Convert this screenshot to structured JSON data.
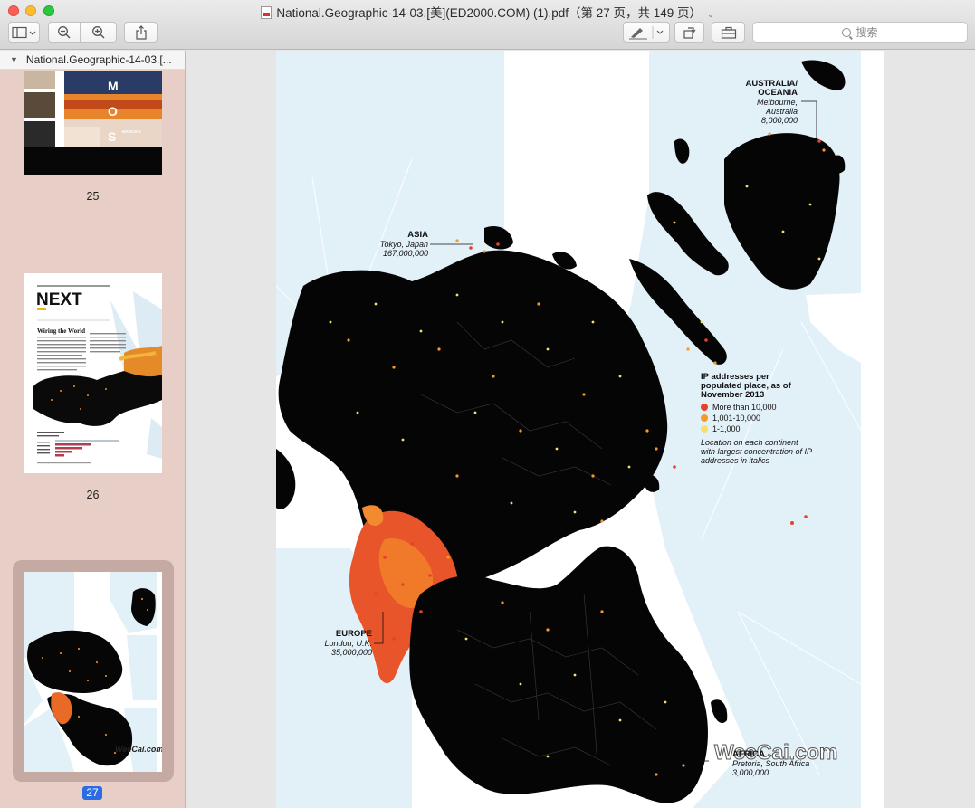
{
  "window": {
    "title": "National.Geographic-14-03.[美](ED2000.COM) (1).pdf（第 27 页，共 149 页）"
  },
  "toolbar": {
    "search_placeholder": "搜索"
  },
  "sidebar": {
    "document_name": "National.Geographic-14-03.[...",
    "pages": [
      {
        "number": "25",
        "letters": [
          "M",
          "O",
          "S"
        ],
        "date": "MARCH 9"
      },
      {
        "number": "26",
        "heading": "NEXT",
        "subheading": "Wiring the World"
      },
      {
        "number": "27",
        "selected": true,
        "watermark": "WeeCai.com"
      }
    ]
  },
  "map": {
    "labels": {
      "australia": {
        "title1": "AUSTRALIA/",
        "title2": "OCEANIA",
        "city1": "Melbourne,",
        "city2": "Australia",
        "count": "8,000,000"
      },
      "asia": {
        "title": "ASIA",
        "city": "Tokyo, Japan",
        "count": "167,000,000"
      },
      "europe": {
        "title": "EUROPE",
        "city": "London, U.K.",
        "count": "35,000,000"
      },
      "africa": {
        "title": "AFRICA",
        "city": "Pretoria, South Africa",
        "count": "3,000,000"
      }
    },
    "legend": {
      "title": "IP addresses per populated place, as of November 2013",
      "items": [
        {
          "label": "More than 10,000",
          "color": "#e8412b"
        },
        {
          "label": "1,001-10,000",
          "color": "#f59a26"
        },
        {
          "label": "1-1,000",
          "color": "#f7df6a"
        }
      ],
      "note": "Location on each continent with largest concentration of IP addresses in italics"
    },
    "watermark": "WeeCai.com",
    "colors": {
      "ocean": "#e2f0f8",
      "land": "#050505",
      "page": "#ffffff"
    }
  }
}
